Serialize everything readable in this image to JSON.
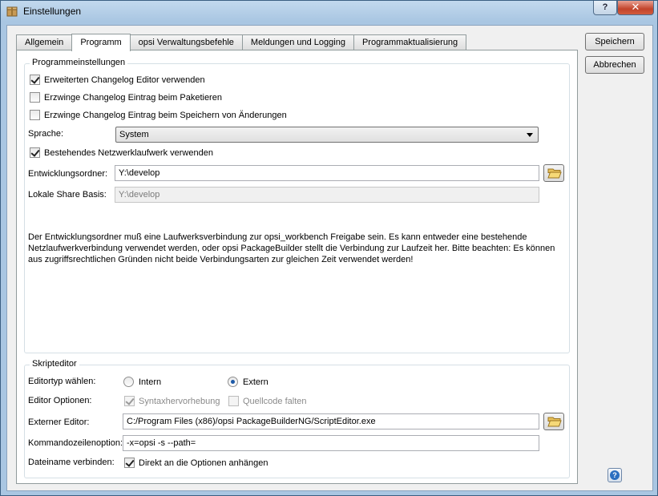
{
  "window": {
    "title": "Einstellungen",
    "help_label": "?",
    "close_label": "✕"
  },
  "tabs": [
    {
      "label": "Allgemein"
    },
    {
      "label": "Programm"
    },
    {
      "label": "opsi Verwaltungsbefehle"
    },
    {
      "label": "Meldungen und Logging"
    },
    {
      "label": "Programmaktualisierung"
    }
  ],
  "buttons": {
    "save": "Speichern",
    "cancel": "Abbrechen"
  },
  "program_settings": {
    "title": "Programmeinstellungen",
    "extended_changelog": {
      "label": "Erweiterten Changelog Editor verwenden",
      "checked": true
    },
    "force_changelog_packaging": {
      "label": "Erzwinge Changelog Eintrag beim Paketieren",
      "checked": false
    },
    "force_changelog_saving": {
      "label": "Erzwinge Changelog Eintrag beim Speichern von Änderungen",
      "checked": false
    },
    "language_label": "Sprache:",
    "language_value": "System",
    "network_drive": {
      "label": "Bestehendes Netzwerklaufwerk verwenden",
      "checked": true
    },
    "dev_folder_label": "Entwicklungsordner:",
    "dev_folder_value": "Y:\\develop",
    "local_share_label": "Lokale Share Basis:",
    "local_share_value": "Y:\\develop",
    "description": "Der Entwicklungsordner muß eine Laufwerksverbindung zur opsi_workbench Freigabe sein. Es kann entweder eine bestehende Netzlaufwerkverbindung verwendet werden, oder opsi PackageBuilder stellt die Verbindung zur Laufzeit her. Bitte beachten: Es können aus zugriffsrechtlichen Gründen nicht beide Verbindungsarten zur gleichen Zeit verwendet werden!"
  },
  "script_editor": {
    "title": "Skripteditor",
    "editor_type_label": "Editortyp wählen:",
    "intern_label": "Intern",
    "extern_label": "Extern",
    "selected": "Extern",
    "options_label": "Editor Optionen:",
    "syntax_highlight": {
      "label": "Syntaxhervorhebung",
      "checked": true
    },
    "code_folding": {
      "label": "Quellcode falten",
      "checked": false
    },
    "external_editor_label": "Externer Editor:",
    "external_editor_value": "C:/Program Files (x86)/opsi PackageBuilderNG/ScriptEditor.exe",
    "cmdline_label": "Kommandozeilenoption:",
    "cmdline_value": "-x=opsi -s --path=",
    "filename_label": "Dateiname verbinden:",
    "append_options": {
      "label": "Direkt an die Optionen anhängen",
      "checked": true
    }
  },
  "colors": {
    "titlebar": "#a9c6e2",
    "close_button": "#c2442b",
    "accent": "#2c6fc0"
  }
}
